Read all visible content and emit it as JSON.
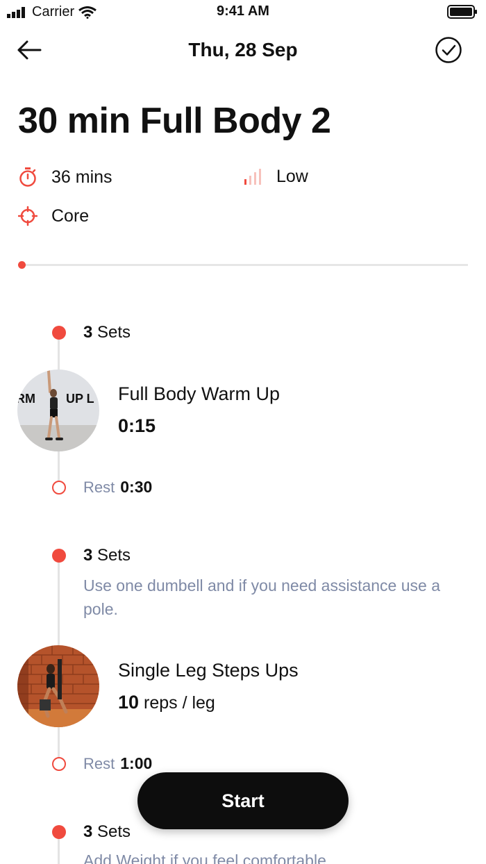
{
  "status_bar": {
    "carrier": "Carrier",
    "time": "9:41 AM"
  },
  "header": {
    "title": "Thu, 28 Sep"
  },
  "workout": {
    "title": "30 min Full Body 2",
    "duration": "36 mins",
    "intensity": "Low",
    "focus": "Core"
  },
  "blocks": [
    {
      "sets_count": "3",
      "sets_label": "Sets",
      "note": "",
      "exercise_name": "Full Body Warm Up",
      "exercise_value": "0:15",
      "exercise_unit": "",
      "thumb_text_left": "RM",
      "thumb_text_right": "UP L",
      "rest_label": "Rest",
      "rest_value": "0:30"
    },
    {
      "sets_count": "3",
      "sets_label": "Sets",
      "note": "Use one dumbell and if you need assistance use a pole.",
      "exercise_name": "Single Leg Steps Ups",
      "exercise_value": "10",
      "exercise_unit": "reps / leg",
      "rest_label": "Rest",
      "rest_value": "1:00"
    },
    {
      "sets_count": "3",
      "sets_label": "Sets",
      "note": "Add Weight if you feel comfortable"
    }
  ],
  "start_button": {
    "label": "Start"
  },
  "colors": {
    "accent": "#f04a3e",
    "muted_text": "#7f8aa6",
    "button_bg": "#0d0d0d"
  }
}
